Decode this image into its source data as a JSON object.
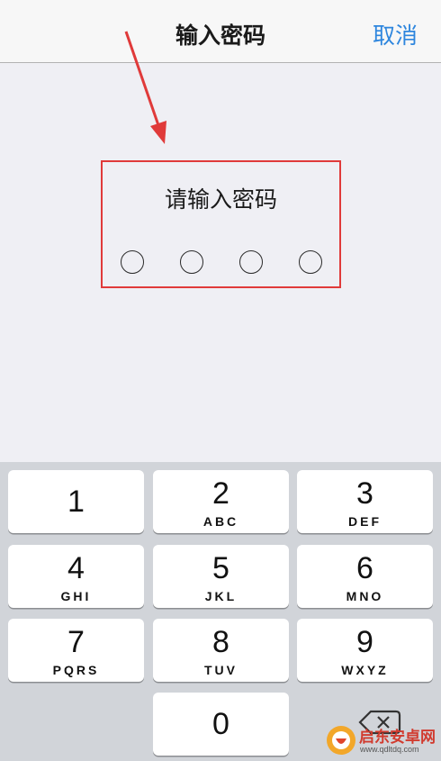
{
  "navbar": {
    "title": "输入密码",
    "cancel_label": "取消"
  },
  "passcode": {
    "prompt": "请输入密码",
    "length": 4,
    "entered": 0
  },
  "keypad": {
    "keys": [
      {
        "digit": "1",
        "letters": ""
      },
      {
        "digit": "2",
        "letters": "ABC"
      },
      {
        "digit": "3",
        "letters": "DEF"
      },
      {
        "digit": "4",
        "letters": "GHI"
      },
      {
        "digit": "5",
        "letters": "JKL"
      },
      {
        "digit": "6",
        "letters": "MNO"
      },
      {
        "digit": "7",
        "letters": "PQRS"
      },
      {
        "digit": "8",
        "letters": "TUV"
      },
      {
        "digit": "9",
        "letters": "WXYZ"
      },
      {
        "digit": "0",
        "letters": ""
      }
    ],
    "delete_icon": "backspace-icon"
  },
  "colors": {
    "accent": "#2e86de",
    "highlight": "#e03a3a",
    "background": "#efeff4",
    "keypad": "#d1d4d9"
  },
  "watermark": {
    "title": "启东安卓网",
    "url": "www.qdltdq.com"
  }
}
